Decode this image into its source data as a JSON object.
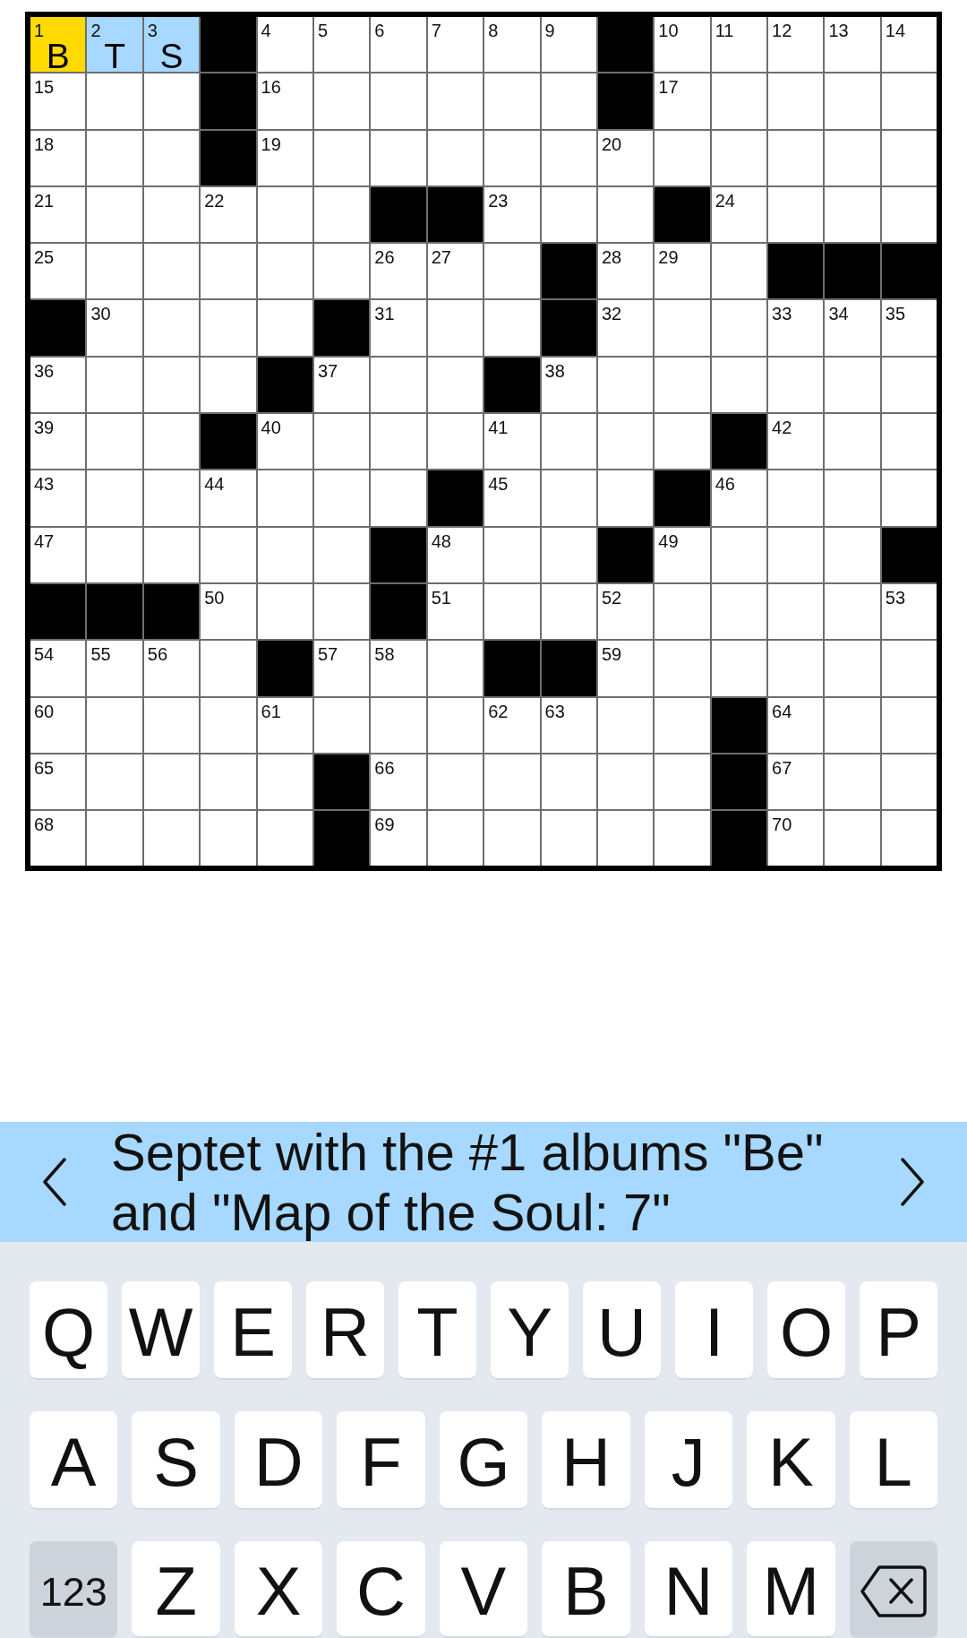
{
  "grid": {
    "rows": [
      [
        {
          "kind": "square",
          "number": "1",
          "letter": "B",
          "selected": true,
          "highlighted": false
        },
        {
          "kind": "square",
          "number": "2",
          "letter": "T",
          "selected": false,
          "highlighted": true
        },
        {
          "kind": "square",
          "number": "3",
          "letter": "S",
          "selected": false,
          "highlighted": true
        },
        {
          "kind": "block"
        },
        {
          "kind": "square",
          "number": "4",
          "selected": false,
          "highlighted": false
        },
        {
          "kind": "square",
          "number": "5",
          "selected": false,
          "highlighted": false
        },
        {
          "kind": "square",
          "number": "6",
          "selected": false,
          "highlighted": false
        },
        {
          "kind": "square",
          "number": "7",
          "selected": false,
          "highlighted": false
        },
        {
          "kind": "square",
          "number": "8",
          "selected": false,
          "highlighted": false
        },
        {
          "kind": "square",
          "number": "9",
          "selected": false,
          "highlighted": false
        },
        {
          "kind": "block"
        },
        {
          "kind": "square",
          "number": "10",
          "selected": false,
          "highlighted": false
        },
        {
          "kind": "square",
          "number": "11",
          "selected": false,
          "highlighted": false
        },
        {
          "kind": "square",
          "number": "12",
          "selected": false,
          "highlighted": false
        },
        {
          "kind": "square",
          "number": "13",
          "selected": false,
          "highlighted": false
        },
        {
          "kind": "square",
          "number": "14",
          "selected": false,
          "highlighted": false
        }
      ],
      [
        {
          "kind": "square",
          "number": "15",
          "selected": false,
          "highlighted": false
        },
        {
          "kind": "square",
          "selected": false,
          "highlighted": false
        },
        {
          "kind": "square",
          "selected": false,
          "highlighted": false
        },
        {
          "kind": "block"
        },
        {
          "kind": "square",
          "number": "16",
          "selected": false,
          "highlighted": false
        },
        {
          "kind": "square",
          "selected": false,
          "highlighted": false
        },
        {
          "kind": "square",
          "selected": false,
          "highlighted": false
        },
        {
          "kind": "square",
          "selected": false,
          "highlighted": false
        },
        {
          "kind": "square",
          "selected": false,
          "highlighted": false
        },
        {
          "kind": "square",
          "selected": false,
          "highlighted": false
        },
        {
          "kind": "block"
        },
        {
          "kind": "square",
          "number": "17",
          "selected": false,
          "highlighted": false
        },
        {
          "kind": "square",
          "selected": false,
          "highlighted": false
        },
        {
          "kind": "square",
          "selected": false,
          "highlighted": false
        },
        {
          "kind": "square",
          "selected": false,
          "highlighted": false
        },
        {
          "kind": "square",
          "selected": false,
          "highlighted": false
        }
      ],
      [
        {
          "kind": "square",
          "number": "18",
          "selected": false,
          "highlighted": false
        },
        {
          "kind": "square",
          "selected": false,
          "highlighted": false
        },
        {
          "kind": "square",
          "selected": false,
          "highlighted": false
        },
        {
          "kind": "block"
        },
        {
          "kind": "square",
          "number": "19",
          "selected": false,
          "highlighted": false
        },
        {
          "kind": "square",
          "selected": false,
          "highlighted": false
        },
        {
          "kind": "square",
          "selected": false,
          "highlighted": false
        },
        {
          "kind": "square",
          "selected": false,
          "highlighted": false
        },
        {
          "kind": "square",
          "selected": false,
          "highlighted": false
        },
        {
          "kind": "square",
          "selected": false,
          "highlighted": false
        },
        {
          "kind": "square",
          "number": "20",
          "selected": false,
          "highlighted": false
        },
        {
          "kind": "square",
          "selected": false,
          "highlighted": false
        },
        {
          "kind": "square",
          "selected": false,
          "highlighted": false
        },
        {
          "kind": "square",
          "selected": false,
          "highlighted": false
        },
        {
          "kind": "square",
          "selected": false,
          "highlighted": false
        },
        {
          "kind": "square",
          "selected": false,
          "highlighted": false
        }
      ],
      [
        {
          "kind": "square",
          "number": "21",
          "selected": false,
          "highlighted": false
        },
        {
          "kind": "square",
          "selected": false,
          "highlighted": false
        },
        {
          "kind": "square",
          "selected": false,
          "highlighted": false
        },
        {
          "kind": "square",
          "number": "22",
          "selected": false,
          "highlighted": false
        },
        {
          "kind": "square",
          "selected": false,
          "highlighted": false
        },
        {
          "kind": "square",
          "selected": false,
          "highlighted": false
        },
        {
          "kind": "block"
        },
        {
          "kind": "block"
        },
        {
          "kind": "square",
          "number": "23",
          "selected": false,
          "highlighted": false
        },
        {
          "kind": "square",
          "selected": false,
          "highlighted": false
        },
        {
          "kind": "square",
          "selected": false,
          "highlighted": false
        },
        {
          "kind": "block"
        },
        {
          "kind": "square",
          "number": "24",
          "selected": false,
          "highlighted": false
        },
        {
          "kind": "square",
          "selected": false,
          "highlighted": false
        },
        {
          "kind": "square",
          "selected": false,
          "highlighted": false
        },
        {
          "kind": "square",
          "selected": false,
          "highlighted": false
        }
      ],
      [
        {
          "kind": "square",
          "number": "25",
          "selected": false,
          "highlighted": false
        },
        {
          "kind": "square",
          "selected": false,
          "highlighted": false
        },
        {
          "kind": "square",
          "selected": false,
          "highlighted": false
        },
        {
          "kind": "square",
          "selected": false,
          "highlighted": false
        },
        {
          "kind": "square",
          "selected": false,
          "highlighted": false
        },
        {
          "kind": "square",
          "selected": false,
          "highlighted": false
        },
        {
          "kind": "square",
          "number": "26",
          "selected": false,
          "highlighted": false
        },
        {
          "kind": "square",
          "number": "27",
          "selected": false,
          "highlighted": false
        },
        {
          "kind": "square",
          "selected": false,
          "highlighted": false
        },
        {
          "kind": "block"
        },
        {
          "kind": "square",
          "number": "28",
          "selected": false,
          "highlighted": false
        },
        {
          "kind": "square",
          "number": "29",
          "selected": false,
          "highlighted": false
        },
        {
          "kind": "square",
          "selected": false,
          "highlighted": false
        },
        {
          "kind": "block"
        },
        {
          "kind": "block"
        },
        {
          "kind": "block"
        }
      ],
      [
        {
          "kind": "block"
        },
        {
          "kind": "square",
          "number": "30",
          "selected": false,
          "highlighted": false
        },
        {
          "kind": "square",
          "selected": false,
          "highlighted": false
        },
        {
          "kind": "square",
          "selected": false,
          "highlighted": false
        },
        {
          "kind": "square",
          "selected": false,
          "highlighted": false
        },
        {
          "kind": "block"
        },
        {
          "kind": "square",
          "number": "31",
          "selected": false,
          "highlighted": false
        },
        {
          "kind": "square",
          "selected": false,
          "highlighted": false
        },
        {
          "kind": "square",
          "selected": false,
          "highlighted": false
        },
        {
          "kind": "block"
        },
        {
          "kind": "square",
          "number": "32",
          "selected": false,
          "highlighted": false
        },
        {
          "kind": "square",
          "selected": false,
          "highlighted": false
        },
        {
          "kind": "square",
          "selected": false,
          "highlighted": false
        },
        {
          "kind": "square",
          "number": "33",
          "selected": false,
          "highlighted": false
        },
        {
          "kind": "square",
          "number": "34",
          "selected": false,
          "highlighted": false
        },
        {
          "kind": "square",
          "number": "35",
          "selected": false,
          "highlighted": false
        }
      ],
      [
        {
          "kind": "square",
          "number": "36",
          "selected": false,
          "highlighted": false
        },
        {
          "kind": "square",
          "selected": false,
          "highlighted": false
        },
        {
          "kind": "square",
          "selected": false,
          "highlighted": false
        },
        {
          "kind": "square",
          "selected": false,
          "highlighted": false
        },
        {
          "kind": "block"
        },
        {
          "kind": "square",
          "number": "37",
          "selected": false,
          "highlighted": false
        },
        {
          "kind": "square",
          "selected": false,
          "highlighted": false
        },
        {
          "kind": "square",
          "selected": false,
          "highlighted": false
        },
        {
          "kind": "block"
        },
        {
          "kind": "square",
          "number": "38",
          "selected": false,
          "highlighted": false
        },
        {
          "kind": "square",
          "selected": false,
          "highlighted": false
        },
        {
          "kind": "square",
          "selected": false,
          "highlighted": false
        },
        {
          "kind": "square",
          "selected": false,
          "highlighted": false
        },
        {
          "kind": "square",
          "selected": false,
          "highlighted": false
        },
        {
          "kind": "square",
          "selected": false,
          "highlighted": false
        },
        {
          "kind": "square",
          "selected": false,
          "highlighted": false
        }
      ],
      [
        {
          "kind": "square",
          "number": "39",
          "selected": false,
          "highlighted": false
        },
        {
          "kind": "square",
          "selected": false,
          "highlighted": false
        },
        {
          "kind": "square",
          "selected": false,
          "highlighted": false
        },
        {
          "kind": "block"
        },
        {
          "kind": "square",
          "number": "40",
          "selected": false,
          "highlighted": false
        },
        {
          "kind": "square",
          "selected": false,
          "highlighted": false
        },
        {
          "kind": "square",
          "selected": false,
          "highlighted": false
        },
        {
          "kind": "square",
          "selected": false,
          "highlighted": false
        },
        {
          "kind": "square",
          "number": "41",
          "selected": false,
          "highlighted": false
        },
        {
          "kind": "square",
          "selected": false,
          "highlighted": false
        },
        {
          "kind": "square",
          "selected": false,
          "highlighted": false
        },
        {
          "kind": "square",
          "selected": false,
          "highlighted": false
        },
        {
          "kind": "block"
        },
        {
          "kind": "square",
          "number": "42",
          "selected": false,
          "highlighted": false
        },
        {
          "kind": "square",
          "selected": false,
          "highlighted": false
        },
        {
          "kind": "square",
          "selected": false,
          "highlighted": false
        }
      ],
      [
        {
          "kind": "square",
          "number": "43",
          "selected": false,
          "highlighted": false
        },
        {
          "kind": "square",
          "selected": false,
          "highlighted": false
        },
        {
          "kind": "square",
          "selected": false,
          "highlighted": false
        },
        {
          "kind": "square",
          "number": "44",
          "selected": false,
          "highlighted": false
        },
        {
          "kind": "square",
          "selected": false,
          "highlighted": false
        },
        {
          "kind": "square",
          "selected": false,
          "highlighted": false
        },
        {
          "kind": "square",
          "selected": false,
          "highlighted": false
        },
        {
          "kind": "block"
        },
        {
          "kind": "square",
          "number": "45",
          "selected": false,
          "highlighted": false
        },
        {
          "kind": "square",
          "selected": false,
          "highlighted": false
        },
        {
          "kind": "square",
          "selected": false,
          "highlighted": false
        },
        {
          "kind": "block"
        },
        {
          "kind": "square",
          "number": "46",
          "selected": false,
          "highlighted": false
        },
        {
          "kind": "square",
          "selected": false,
          "highlighted": false
        },
        {
          "kind": "square",
          "selected": false,
          "highlighted": false
        },
        {
          "kind": "square",
          "selected": false,
          "highlighted": false
        }
      ],
      [
        {
          "kind": "square",
          "number": "47",
          "selected": false,
          "highlighted": false
        },
        {
          "kind": "square",
          "selected": false,
          "highlighted": false
        },
        {
          "kind": "square",
          "selected": false,
          "highlighted": false
        },
        {
          "kind": "square",
          "selected": false,
          "highlighted": false
        },
        {
          "kind": "square",
          "selected": false,
          "highlighted": false
        },
        {
          "kind": "square",
          "selected": false,
          "highlighted": false
        },
        {
          "kind": "block"
        },
        {
          "kind": "square",
          "number": "48",
          "selected": false,
          "highlighted": false
        },
        {
          "kind": "square",
          "selected": false,
          "highlighted": false
        },
        {
          "kind": "square",
          "selected": false,
          "highlighted": false
        },
        {
          "kind": "block"
        },
        {
          "kind": "square",
          "number": "49",
          "selected": false,
          "highlighted": false
        },
        {
          "kind": "square",
          "selected": false,
          "highlighted": false
        },
        {
          "kind": "square",
          "selected": false,
          "highlighted": false
        },
        {
          "kind": "square",
          "selected": false,
          "highlighted": false
        },
        {
          "kind": "block"
        }
      ],
      [
        {
          "kind": "block"
        },
        {
          "kind": "block"
        },
        {
          "kind": "block"
        },
        {
          "kind": "square",
          "number": "50",
          "selected": false,
          "highlighted": false
        },
        {
          "kind": "square",
          "selected": false,
          "highlighted": false
        },
        {
          "kind": "square",
          "selected": false,
          "highlighted": false
        },
        {
          "kind": "block"
        },
        {
          "kind": "square",
          "number": "51",
          "selected": false,
          "highlighted": false
        },
        {
          "kind": "square",
          "selected": false,
          "highlighted": false
        },
        {
          "kind": "square",
          "selected": false,
          "highlighted": false
        },
        {
          "kind": "square",
          "number": "52",
          "selected": false,
          "highlighted": false
        },
        {
          "kind": "square",
          "selected": false,
          "highlighted": false
        },
        {
          "kind": "square",
          "selected": false,
          "highlighted": false
        },
        {
          "kind": "square",
          "selected": false,
          "highlighted": false
        },
        {
          "kind": "square",
          "selected": false,
          "highlighted": false
        },
        {
          "kind": "square",
          "number": "53",
          "selected": false,
          "highlighted": false
        }
      ],
      [
        {
          "kind": "square",
          "number": "54",
          "selected": false,
          "highlighted": false
        },
        {
          "kind": "square",
          "number": "55",
          "selected": false,
          "highlighted": false
        },
        {
          "kind": "square",
          "number": "56",
          "selected": false,
          "highlighted": false
        },
        {
          "kind": "square",
          "selected": false,
          "highlighted": false
        },
        {
          "kind": "block"
        },
        {
          "kind": "square",
          "number": "57",
          "selected": false,
          "highlighted": false
        },
        {
          "kind": "square",
          "number": "58",
          "selected": false,
          "highlighted": false
        },
        {
          "kind": "square",
          "selected": false,
          "highlighted": false
        },
        {
          "kind": "block"
        },
        {
          "kind": "block"
        },
        {
          "kind": "square",
          "number": "59",
          "selected": false,
          "highlighted": false
        },
        {
          "kind": "square",
          "selected": false,
          "highlighted": false
        },
        {
          "kind": "square",
          "selected": false,
          "highlighted": false
        },
        {
          "kind": "square",
          "selected": false,
          "highlighted": false
        },
        {
          "kind": "square",
          "selected": false,
          "highlighted": false
        },
        {
          "kind": "square",
          "selected": false,
          "highlighted": false
        }
      ],
      [
        {
          "kind": "square",
          "number": "60",
          "selected": false,
          "highlighted": false
        },
        {
          "kind": "square",
          "selected": false,
          "highlighted": false
        },
        {
          "kind": "square",
          "selected": false,
          "highlighted": false
        },
        {
          "kind": "square",
          "selected": false,
          "highlighted": false
        },
        {
          "kind": "square",
          "number": "61",
          "selected": false,
          "highlighted": false
        },
        {
          "kind": "square",
          "selected": false,
          "highlighted": false
        },
        {
          "kind": "square",
          "selected": false,
          "highlighted": false
        },
        {
          "kind": "square",
          "selected": false,
          "highlighted": false
        },
        {
          "kind": "square",
          "number": "62",
          "selected": false,
          "highlighted": false
        },
        {
          "kind": "square",
          "number": "63",
          "selected": false,
          "highlighted": false
        },
        {
          "kind": "square",
          "selected": false,
          "highlighted": false
        },
        {
          "kind": "square",
          "selected": false,
          "highlighted": false
        },
        {
          "kind": "block"
        },
        {
          "kind": "square",
          "number": "64",
          "selected": false,
          "highlighted": false
        },
        {
          "kind": "square",
          "selected": false,
          "highlighted": false
        },
        {
          "kind": "square",
          "selected": false,
          "highlighted": false
        }
      ],
      [
        {
          "kind": "square",
          "number": "65",
          "selected": false,
          "highlighted": false
        },
        {
          "kind": "square",
          "selected": false,
          "highlighted": false
        },
        {
          "kind": "square",
          "selected": false,
          "highlighted": false
        },
        {
          "kind": "square",
          "selected": false,
          "highlighted": false
        },
        {
          "kind": "square",
          "selected": false,
          "highlighted": false
        },
        {
          "kind": "block"
        },
        {
          "kind": "square",
          "number": "66",
          "selected": false,
          "highlighted": false
        },
        {
          "kind": "square",
          "selected": false,
          "highlighted": false
        },
        {
          "kind": "square",
          "selected": false,
          "highlighted": false
        },
        {
          "kind": "square",
          "selected": false,
          "highlighted": false
        },
        {
          "kind": "square",
          "selected": false,
          "highlighted": false
        },
        {
          "kind": "square",
          "selected": false,
          "highlighted": false
        },
        {
          "kind": "block"
        },
        {
          "kind": "square",
          "number": "67",
          "selected": false,
          "highlighted": false
        },
        {
          "kind": "square",
          "selected": false,
          "highlighted": false
        },
        {
          "kind": "square",
          "selected": false,
          "highlighted": false
        }
      ],
      [
        {
          "kind": "square",
          "number": "68",
          "selected": false,
          "highlighted": false
        },
        {
          "kind": "square",
          "selected": false,
          "highlighted": false
        },
        {
          "kind": "square",
          "selected": false,
          "highlighted": false
        },
        {
          "kind": "square",
          "selected": false,
          "highlighted": false
        },
        {
          "kind": "square",
          "selected": false,
          "highlighted": false
        },
        {
          "kind": "block"
        },
        {
          "kind": "square",
          "number": "69",
          "selected": false,
          "highlighted": false
        },
        {
          "kind": "square",
          "selected": false,
          "highlighted": false
        },
        {
          "kind": "square",
          "selected": false,
          "highlighted": false
        },
        {
          "kind": "square",
          "selected": false,
          "highlighted": false
        },
        {
          "kind": "square",
          "selected": false,
          "highlighted": false
        },
        {
          "kind": "square",
          "selected": false,
          "highlighted": false
        },
        {
          "kind": "block"
        },
        {
          "kind": "square",
          "number": "70",
          "selected": false,
          "highlighted": false
        },
        {
          "kind": "square",
          "selected": false,
          "highlighted": false
        },
        {
          "kind": "square",
          "selected": false,
          "highlighted": false
        }
      ]
    ]
  },
  "clue_bar": {
    "text": "Septet with the #1 albums \"Be\" and \"Map of the Soul: 7\""
  },
  "keyboard": {
    "top_keys": [
      {
        "kind": "letter",
        "label": "Q"
      },
      {
        "kind": "letter",
        "label": "W"
      },
      {
        "kind": "letter",
        "label": "E"
      },
      {
        "kind": "letter",
        "label": "R"
      },
      {
        "kind": "letter",
        "label": "T"
      },
      {
        "kind": "letter",
        "label": "Y"
      },
      {
        "kind": "letter",
        "label": "U"
      },
      {
        "kind": "letter",
        "label": "I"
      },
      {
        "kind": "letter",
        "label": "O"
      },
      {
        "kind": "letter",
        "label": "P"
      }
    ],
    "middle_keys": [
      {
        "kind": "letter",
        "label": "A"
      },
      {
        "kind": "letter",
        "label": "S"
      },
      {
        "kind": "letter",
        "label": "D"
      },
      {
        "kind": "letter",
        "label": "F"
      },
      {
        "kind": "letter",
        "label": "G"
      },
      {
        "kind": "letter",
        "label": "H"
      },
      {
        "kind": "letter",
        "label": "J"
      },
      {
        "kind": "letter",
        "label": "K"
      },
      {
        "kind": "letter",
        "label": "L"
      }
    ],
    "bottom_keys": [
      {
        "kind": "mode",
        "label": "123"
      },
      {
        "kind": "letter",
        "label": "Z"
      },
      {
        "kind": "letter",
        "label": "X"
      },
      {
        "kind": "letter",
        "label": "C"
      },
      {
        "kind": "letter",
        "label": "V"
      },
      {
        "kind": "letter",
        "label": "B"
      },
      {
        "kind": "letter",
        "label": "N"
      },
      {
        "kind": "letter",
        "label": "M"
      },
      {
        "kind": "backspace"
      }
    ]
  }
}
